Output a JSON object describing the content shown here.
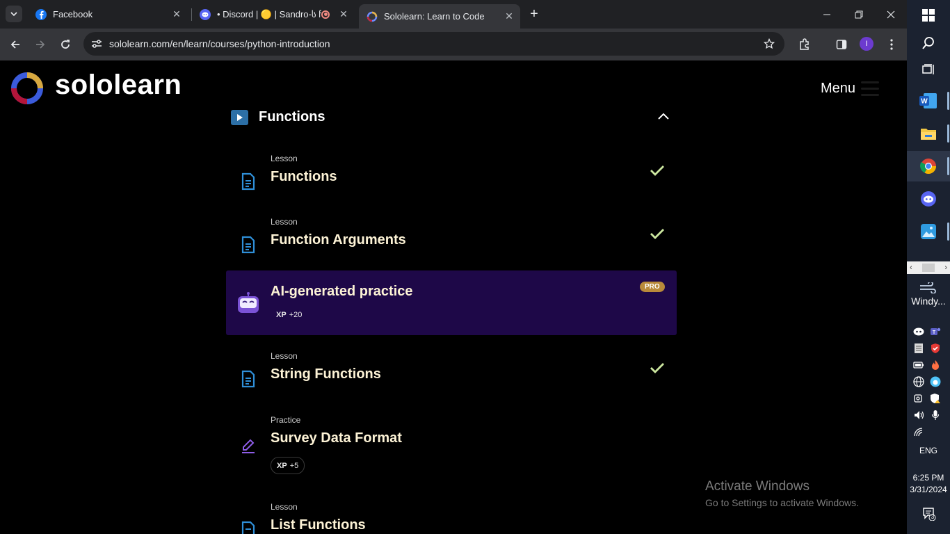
{
  "browser": {
    "tabs": [
      {
        "title": "Facebook",
        "active": false
      },
      {
        "title": "• Discord | 🟡 | Sandro-ს ჩა",
        "active": false
      },
      {
        "title": "Sololearn: Learn to Code",
        "active": true
      }
    ],
    "url": "sololearn.com/en/learn/courses/python-introduction",
    "profile_initial": "I"
  },
  "site": {
    "brand": "sololearn",
    "menu_label": "Menu"
  },
  "module": {
    "title": "Functions"
  },
  "items": [
    {
      "kind": "Lesson",
      "title": "Functions",
      "completed": true
    },
    {
      "kind": "Lesson",
      "title": "Function Arguments",
      "completed": true
    },
    {
      "kind": "Lesson",
      "title": "String Functions",
      "completed": true
    },
    {
      "kind": "Practice",
      "title": "Survey Data Format",
      "xp_label": "XP",
      "xp_value": "+5"
    },
    {
      "kind": "Lesson",
      "title": "List Functions"
    }
  ],
  "ai_practice": {
    "title": "AI-generated practice",
    "badge": "PRO",
    "xp_label": "XP",
    "xp_value": "+20"
  },
  "watermark": {
    "line1": "Activate Windows",
    "line2": "Go to Settings to activate Windows."
  },
  "taskbar": {
    "widget_label": "Windy...",
    "language": "ENG",
    "time": "6:25 PM",
    "date": "3/31/2024",
    "notifications": "3"
  },
  "colors": {
    "accent_purple": "#1e0848",
    "pro_badge": "#b98a3a",
    "lesson_icon": "#2f8fd8",
    "check": "#cde8a0"
  }
}
